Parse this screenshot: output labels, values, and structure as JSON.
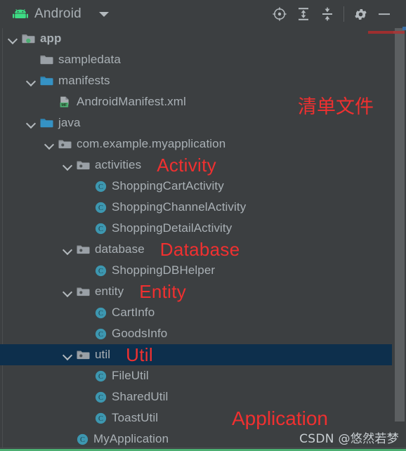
{
  "window": {
    "title": "Android",
    "logo_icon": "android-robot-icon",
    "caret_icon": "chevron-down-icon"
  },
  "toolbar": {
    "buttons": [
      {
        "name": "select-opened-file-button",
        "icon": "crosshair-target-icon",
        "label": "Select Opened File"
      },
      {
        "name": "expand-all-button",
        "icon": "expand-all-icon",
        "label": "Expand All"
      },
      {
        "name": "collapse-all-button",
        "icon": "collapse-all-icon",
        "label": "Collapse All"
      },
      {
        "name": "settings-button",
        "icon": "gear-icon",
        "label": "Settings"
      },
      {
        "name": "hide-button",
        "icon": "minimize-dash-icon",
        "label": "Hide"
      }
    ]
  },
  "tree": {
    "rows": [
      {
        "id": "app",
        "label": "app",
        "indent": 0,
        "arrow": "expanded",
        "icon": "module-folder-icon",
        "bold": true,
        "error": true,
        "selected": false,
        "annotation": ""
      },
      {
        "id": "sampledata",
        "label": "sampledata",
        "indent": 1,
        "arrow": "none",
        "icon": "folder-gray-icon",
        "bold": false,
        "error": false,
        "selected": false,
        "annotation": ""
      },
      {
        "id": "manifests",
        "label": "manifests",
        "indent": 1,
        "arrow": "expanded",
        "icon": "folder-blue-icon",
        "bold": false,
        "error": false,
        "selected": false,
        "annotation": ""
      },
      {
        "id": "android-manifest-xml",
        "label": "AndroidManifest.xml",
        "indent": 2,
        "arrow": "none",
        "icon": "manifest-file-icon",
        "bold": false,
        "error": false,
        "selected": false,
        "annotation": ""
      },
      {
        "id": "java",
        "label": "java",
        "indent": 1,
        "arrow": "expanded",
        "icon": "folder-blue-icon",
        "bold": false,
        "error": false,
        "selected": false,
        "annotation": ""
      },
      {
        "id": "package-root",
        "label": "com.example.myapplication",
        "indent": 2,
        "arrow": "expanded",
        "icon": "package-icon",
        "bold": false,
        "error": false,
        "selected": false,
        "annotation": ""
      },
      {
        "id": "activities",
        "label": "activities",
        "indent": 3,
        "arrow": "expanded",
        "icon": "package-icon",
        "bold": false,
        "error": false,
        "selected": false,
        "annotation": "Activity"
      },
      {
        "id": "shopping-cart-activity",
        "label": "ShoppingCartActivity",
        "indent": 4,
        "arrow": "none",
        "icon": "java-class-icon",
        "bold": false,
        "error": false,
        "selected": false,
        "annotation": ""
      },
      {
        "id": "shopping-channel-activity",
        "label": "ShoppingChannelActivity",
        "indent": 4,
        "arrow": "none",
        "icon": "java-class-icon",
        "bold": false,
        "error": false,
        "selected": false,
        "annotation": ""
      },
      {
        "id": "shopping-detail-activity",
        "label": "ShoppingDetailActivity",
        "indent": 4,
        "arrow": "none",
        "icon": "java-class-icon",
        "bold": false,
        "error": false,
        "selected": false,
        "annotation": ""
      },
      {
        "id": "database",
        "label": "database",
        "indent": 3,
        "arrow": "expanded",
        "icon": "package-icon",
        "bold": false,
        "error": false,
        "selected": false,
        "annotation": "Database"
      },
      {
        "id": "shopping-db-helper",
        "label": "ShoppingDBHelper",
        "indent": 4,
        "arrow": "none",
        "icon": "java-class-icon",
        "bold": false,
        "error": false,
        "selected": false,
        "annotation": ""
      },
      {
        "id": "entity",
        "label": "entity",
        "indent": 3,
        "arrow": "expanded",
        "icon": "package-icon",
        "bold": false,
        "error": false,
        "selected": false,
        "annotation": "Entity"
      },
      {
        "id": "cart-info",
        "label": "CartInfo",
        "indent": 4,
        "arrow": "none",
        "icon": "java-class-icon",
        "bold": false,
        "error": false,
        "selected": false,
        "annotation": ""
      },
      {
        "id": "goods-info",
        "label": "GoodsInfo",
        "indent": 4,
        "arrow": "none",
        "icon": "java-class-icon",
        "bold": false,
        "error": false,
        "selected": false,
        "annotation": ""
      },
      {
        "id": "util",
        "label": "util",
        "indent": 3,
        "arrow": "expanded",
        "icon": "package-icon",
        "bold": false,
        "error": false,
        "selected": true,
        "annotation": "Util"
      },
      {
        "id": "file-util",
        "label": "FileUtil",
        "indent": 4,
        "arrow": "none",
        "icon": "java-class-icon",
        "bold": false,
        "error": false,
        "selected": false,
        "annotation": ""
      },
      {
        "id": "shared-util",
        "label": "SharedUtil",
        "indent": 4,
        "arrow": "none",
        "icon": "java-class-icon",
        "bold": false,
        "error": false,
        "selected": false,
        "annotation": ""
      },
      {
        "id": "toast-util",
        "label": "ToastUtil",
        "indent": 4,
        "arrow": "none",
        "icon": "java-class-icon",
        "bold": false,
        "error": false,
        "selected": false,
        "annotation": ""
      },
      {
        "id": "my-application",
        "label": "MyApplication",
        "indent": 3,
        "arrow": "none",
        "icon": "java-class-icon",
        "bold": false,
        "error": false,
        "selected": false,
        "annotation": ""
      }
    ]
  },
  "annotations": {
    "manifest_cn": "清单文件",
    "application": "Application"
  },
  "watermark": "CSDN @悠然若梦",
  "colors": {
    "background": "#3c3f41",
    "text": "#a9b0b5",
    "annotation_red": "#f03030",
    "selection": "#0d2f4c",
    "folder_blue": "#3592c4",
    "class_teal": "#3d97b0",
    "android_green": "#3ddc84",
    "scrollbar": "#5c5f61",
    "error_stripe": "#9e2f2f"
  }
}
